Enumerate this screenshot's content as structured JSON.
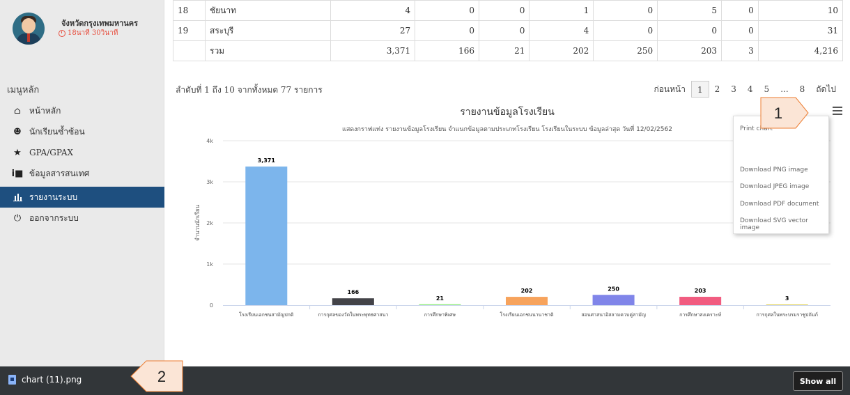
{
  "profile": {
    "province": "จังหวัดกรุงเทพมหานคร",
    "timer": "18นาที 30วินาที"
  },
  "menu": {
    "heading": "เมนูหลัก",
    "items": [
      {
        "label": "หน้าหลัก",
        "icon": "home-icon",
        "active": false
      },
      {
        "label": "นักเรียนซ้ำซ้อน",
        "icon": "users-icon",
        "active": false
      },
      {
        "label": "GPA/GPAX",
        "icon": "star-icon",
        "active": false
      },
      {
        "label": "ข้อมูลสารสนเทศ",
        "icon": "info-icon",
        "active": false
      },
      {
        "label": "รายงานระบบ",
        "icon": "bar-chart-icon",
        "active": true
      },
      {
        "label": "ออกจากระบบ",
        "icon": "power-icon",
        "active": false
      }
    ]
  },
  "table": {
    "rows": [
      [
        "18",
        "ชัยนาท",
        "4",
        "0",
        "0",
        "1",
        "0",
        "5",
        "0",
        "10"
      ],
      [
        "19",
        "สระบุรี",
        "27",
        "0",
        "0",
        "4",
        "0",
        "0",
        "0",
        "31"
      ],
      [
        "",
        "รวม",
        "3,371",
        "166",
        "21",
        "202",
        "250",
        "203",
        "3",
        "4,216"
      ]
    ]
  },
  "pagination": {
    "info": "ลำดับที่ 1 ถึง 10 จากทั้งหมด 77 รายการ",
    "prev": "ก่อนหน้า",
    "pages": [
      "1",
      "2",
      "3",
      "4",
      "5",
      "...",
      "8"
    ],
    "next": "ถัดไป"
  },
  "chart_data": {
    "type": "bar",
    "title": "รายงานข้อมูลโรงเรียน",
    "subtitle": "แสดงกราฟแท่ง รายงานข้อมูลโรงเรียน จำแนกข้อมูลตามประเภทโรงเรียน โรงเรียนในระบบ ข้อมูลล่าสุด วันที่ 12/02/2562",
    "ylabel": "จำนวนนักเรียน",
    "ylim": [
      0,
      4000
    ],
    "yticks": [
      "0",
      "1k",
      "2k",
      "3k",
      "4k"
    ],
    "categories": [
      "โรงเรียนเอกชนสามัญปกติ",
      "การกุศลของวัดในพระพุทธศาสนา",
      "การศึกษาพิเศษ",
      "โรงเรียนเอกชนนานาชาติ",
      "สอนศาสนาอิสลามควบคู่สามัญ",
      "การศึกษาสงเคราะห์",
      "การกุศลในพระบรมราชูปถัมภ์"
    ],
    "values": [
      3371,
      166,
      21,
      202,
      250,
      203,
      3
    ],
    "value_labels": [
      "3,371",
      "166",
      "21",
      "202",
      "250",
      "203",
      "3"
    ],
    "colors": [
      "#7cb5ec",
      "#434348",
      "#90ed7d",
      "#f7a35c",
      "#8085e9",
      "#f15c80",
      "#e4d354"
    ],
    "grid": true,
    "legend": "none"
  },
  "export_menu": [
    "Print chart",
    "Download PNG image",
    "Download JPEG image",
    "Download PDF document",
    "Download SVG vector image"
  ],
  "callouts": [
    "1",
    "2"
  ],
  "download": {
    "filename": "chart (11).png",
    "show_all": "Show all"
  }
}
